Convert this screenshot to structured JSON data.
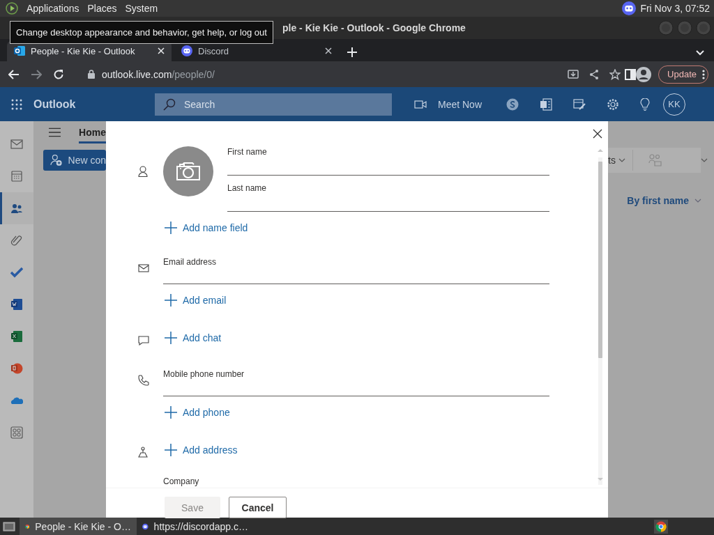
{
  "top_panel": {
    "menus": [
      "Applications",
      "Places",
      "System"
    ],
    "clock": "Fri Nov 3, 07:52"
  },
  "tooltip": "Change desktop appearance and behavior, get help, or log out",
  "browser": {
    "window_title": "ple - Kie Kie - Outlook - Google Chrome",
    "tabs": [
      {
        "title": "People - Kie Kie - Outlook",
        "kind": "outlook",
        "selected": true
      },
      {
        "title": "Discord",
        "kind": "discord",
        "selected": false
      }
    ],
    "url": {
      "host": "outlook.live.com",
      "path": "/people/0/"
    },
    "update_button": "Update"
  },
  "outlook": {
    "app_name": "Outlook",
    "search": {
      "placeholder": "Search"
    },
    "meet_now": "Meet Now",
    "account_initials": "KK",
    "rail": [
      {
        "kind": "mail",
        "selected": false
      },
      {
        "kind": "calendar",
        "selected": false
      },
      {
        "kind": "people",
        "selected": true
      },
      {
        "kind": "attachments",
        "selected": false
      },
      {
        "kind": "todo",
        "selected": false
      },
      {
        "kind": "word",
        "selected": false
      },
      {
        "kind": "excel",
        "selected": false
      },
      {
        "kind": "powerpoint",
        "selected": false
      },
      {
        "kind": "onedrive",
        "selected": false
      },
      {
        "kind": "apps",
        "selected": false
      }
    ],
    "ribbon_tabs": [
      {
        "label": "Home",
        "selected": true
      }
    ],
    "new_contact_button": "New con",
    "command_fragment": "ts",
    "sort": "By first name"
  },
  "dialog": {
    "sections": [
      {
        "kind": "name",
        "fields": [
          {
            "label": "First name"
          },
          {
            "label": "Last name"
          }
        ],
        "add_link": "Add name field"
      },
      {
        "kind": "email",
        "fields": [
          {
            "label": "Email address"
          }
        ],
        "add_link": "Add email"
      },
      {
        "kind": "chat",
        "add_link": "Add chat"
      },
      {
        "kind": "phone",
        "fields": [
          {
            "label": "Mobile phone number"
          }
        ],
        "add_link": "Add phone"
      },
      {
        "kind": "address",
        "add_link": "Add address"
      },
      {
        "kind": "company",
        "fields": [
          {
            "label": "Company"
          }
        ]
      }
    ],
    "buttons": [
      {
        "label": "Save",
        "kind": "primary",
        "disabled": true
      },
      {
        "label": "Cancel",
        "kind": "secondary",
        "disabled": false
      }
    ]
  },
  "taskbar": {
    "items": [
      {
        "label": "People - Kie Kie - O…",
        "kind": "chrome",
        "selected": true
      },
      {
        "label": "https://discordapp.c…",
        "kind": "discord",
        "selected": false
      }
    ]
  }
}
